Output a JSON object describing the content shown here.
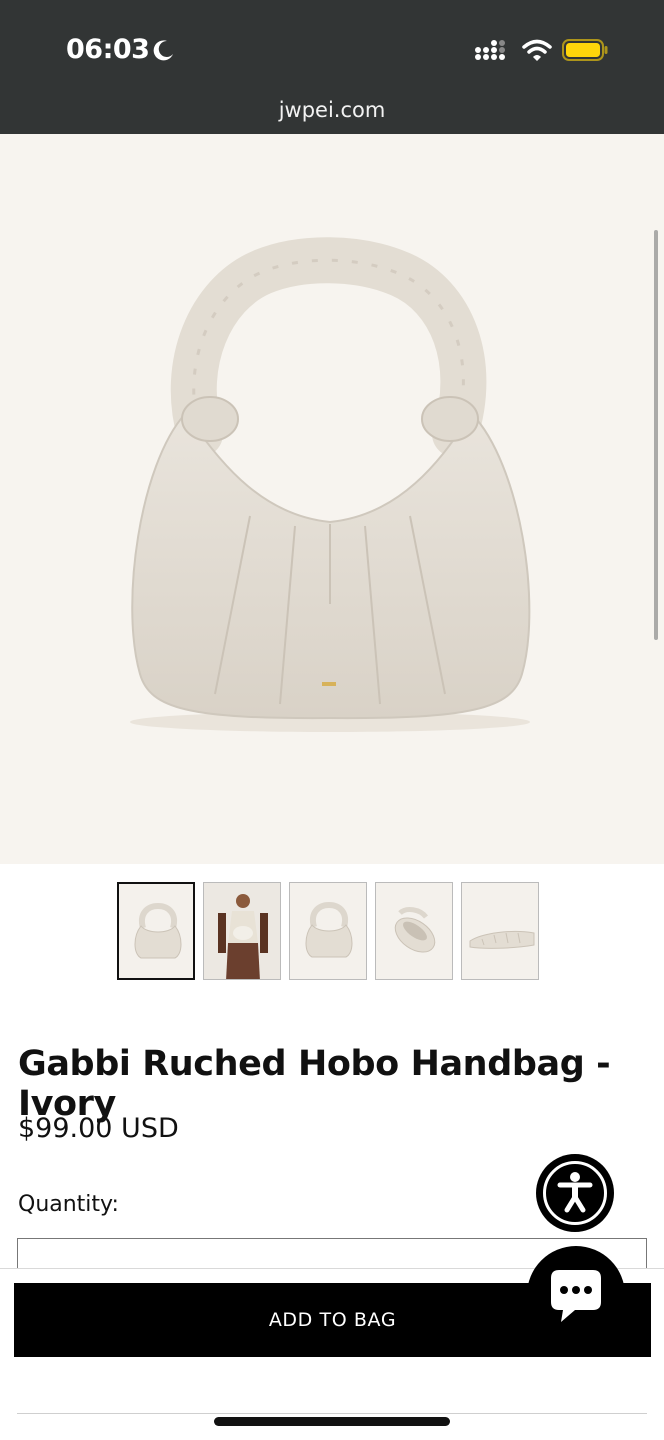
{
  "status_bar": {
    "time": "06:03",
    "url": "jwpei.com"
  },
  "product": {
    "title": "Gabbi Ruched Hobo Handbag - Ivory",
    "price": "$99.00 USD",
    "quantity_label": "Quantity:",
    "quantity_value": ""
  },
  "thumbnails": [
    {
      "icon": "bag-front"
    },
    {
      "icon": "model"
    },
    {
      "icon": "bag-front"
    },
    {
      "icon": "bag-angle"
    },
    {
      "icon": "bag-flat"
    }
  ],
  "actions": {
    "add_to_bag": "ADD TO BAG"
  },
  "colors": {
    "status_bg": "#323535",
    "hero_bg": "#f7f4ef",
    "bag": "#e4dfd6",
    "accent": "#000000",
    "battery": "#ffd60a"
  }
}
